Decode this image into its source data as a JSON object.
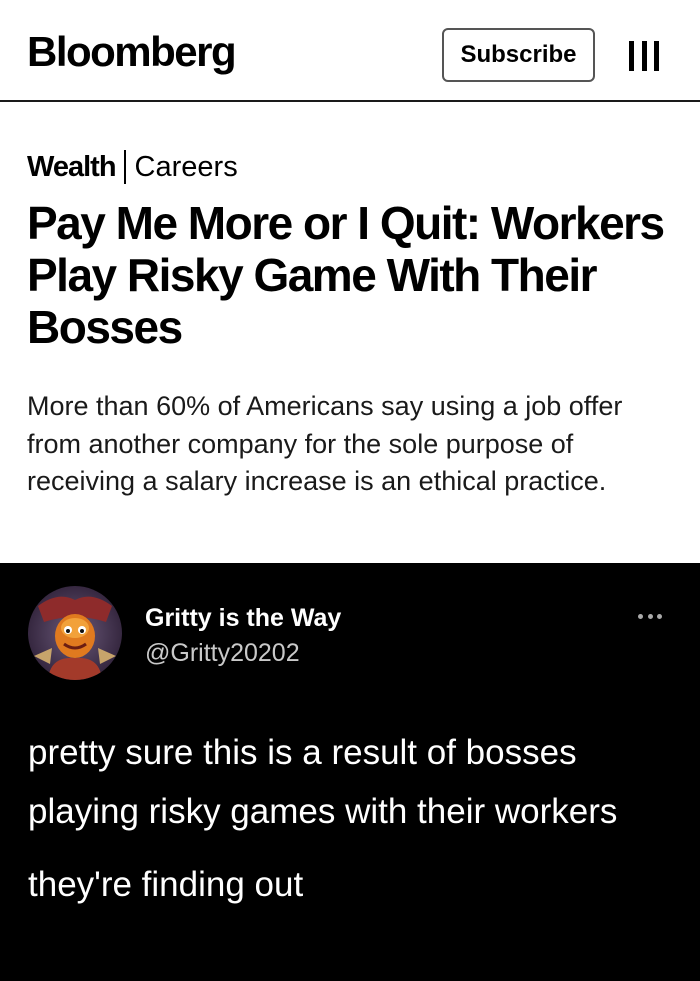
{
  "article": {
    "logo": "Bloomberg",
    "subscribe_label": "Subscribe",
    "section": "Wealth",
    "subsection": "Careers",
    "headline": "Pay Me More or I Quit: Workers Play Risky Game With Their Bosses",
    "dek": "More than 60% of Americans say using a job offer from another company for the sole purpose of receiving a salary increase is an ethical practice."
  },
  "tweet": {
    "display_name": "Gritty is the Way",
    "handle": "@Gritty20202",
    "text_line1": "pretty sure this is a result of bosses playing risky games with their workers",
    "text_line2": "they're finding out"
  },
  "colors": {
    "article_bg": "#ffffff",
    "tweet_bg": "#000000",
    "handle_gray": "#c9c9c9"
  },
  "icons": [
    "menu-icon",
    "more-options-icon"
  ]
}
